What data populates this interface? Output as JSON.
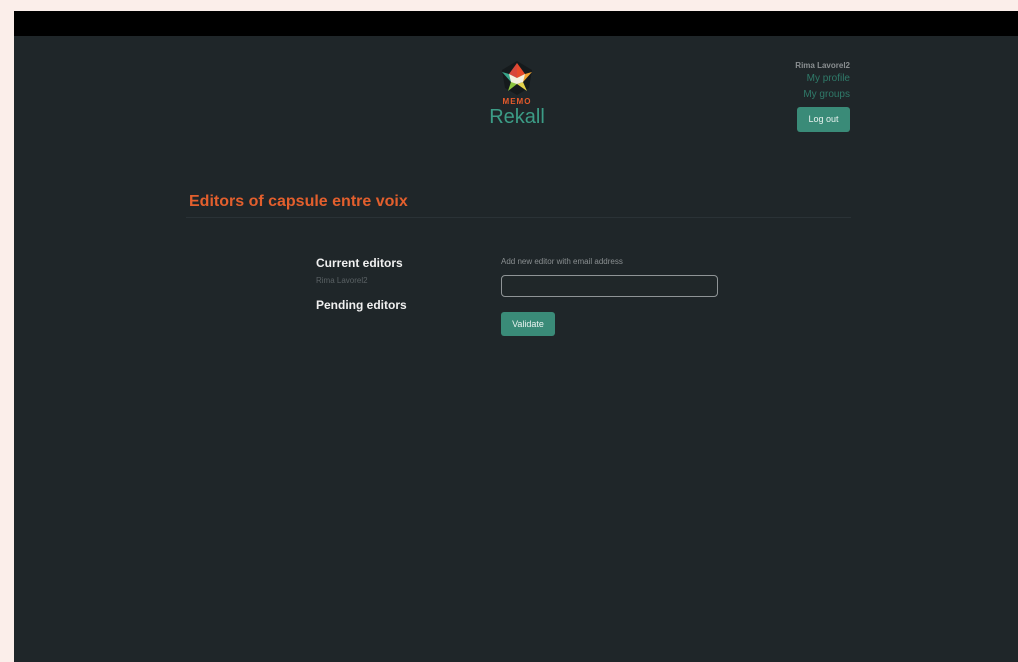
{
  "app": {
    "logo_small": "MEMO",
    "logo_name": "Rekall"
  },
  "user": {
    "name": "Rima Lavorel2",
    "menu": [
      "My profile",
      "My groups"
    ],
    "logout_label": "Log out"
  },
  "page": {
    "title": "Editors of capsule entre voix"
  },
  "editors": {
    "current_heading": "Current editors",
    "current_list": [
      "Rima Lavorel2"
    ],
    "pending_heading": "Pending editors"
  },
  "add_editor": {
    "label": "Add new editor with email address",
    "value": "",
    "validate_label": "Validate"
  },
  "colors": {
    "background": "#1f2629",
    "accent": "#3a8b78",
    "title": "#e35f2d"
  }
}
